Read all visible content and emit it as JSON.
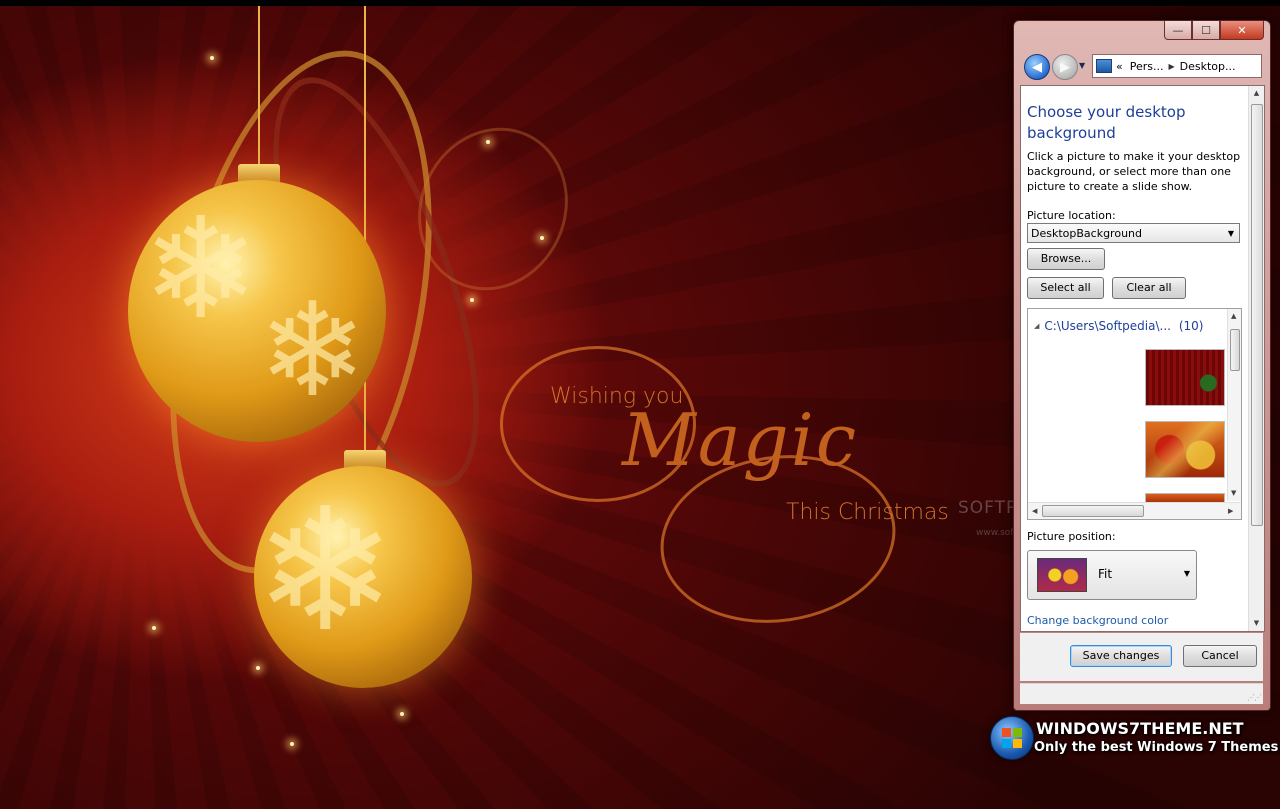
{
  "wallpaper": {
    "line1": "Wishing you",
    "line2": "Magic",
    "line3": "This Christmas",
    "watermark": "SOFTPEDIA",
    "watermark_url": "www.softpedia.com"
  },
  "window": {
    "controls": {
      "minimize": "—",
      "maximize": "☐",
      "close": "✕"
    },
    "nav": {
      "back_icon": "arrow-left-icon",
      "forward_icon": "arrow-right-icon"
    },
    "address": {
      "prefix": "«",
      "crumb1": "Pers...",
      "crumb2": "Desktop..."
    },
    "heading": "Choose your desktop background",
    "description": "Click a picture to make it your desktop background, or select more than one picture to create a slide show.",
    "picture_location_label": "Picture location:",
    "picture_location_value": "DesktopBackground",
    "browse_button": "Browse...",
    "select_all_button": "Select all",
    "clear_all_button": "Clear all",
    "group": {
      "path": "C:\\Users\\Softpedia\\...",
      "count": "(10)"
    },
    "picture_position_label": "Picture position:",
    "picture_position_value": "Fit",
    "change_color_link": "Change background color",
    "save_button": "Save changes",
    "cancel_button": "Cancel"
  },
  "branding": {
    "site": "WINDOWS7THEME.NET",
    "tagline": "Only the best Windows 7 Themes"
  },
  "colors": {
    "heading_blue": "#1e3f9a",
    "link_blue": "#1e5aa8",
    "window_frame": "#c9928f",
    "wallpaper_red": "#7a0c0c",
    "ornament_gold": "#e09a18"
  }
}
